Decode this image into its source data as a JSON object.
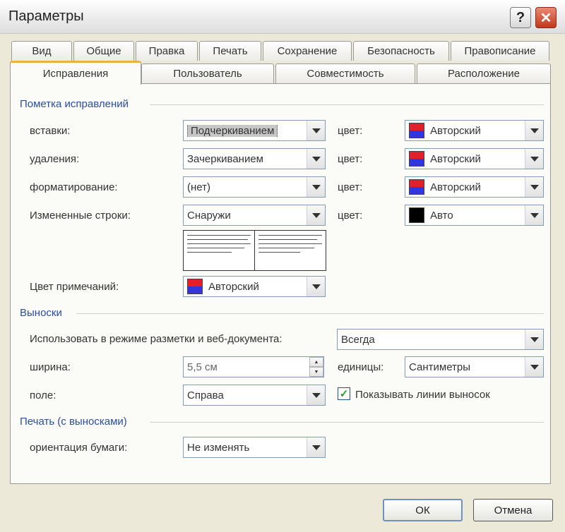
{
  "window": {
    "title": "Параметры",
    "help_label": "?",
    "close_label": "✕"
  },
  "tabs_top": [
    "Вид",
    "Общие",
    "Правка",
    "Печать",
    "Сохранение",
    "Безопасность",
    "Правописание"
  ],
  "tabs_bottom": [
    "Исправления",
    "Пользователь",
    "Совместимость",
    "Расположение"
  ],
  "groups": {
    "markup": "Пометка исправлений",
    "balloons": "Выноски",
    "print": "Печать (с выносками)"
  },
  "markup": {
    "insertions": {
      "label": "вставки:",
      "value": "Подчеркиванием",
      "color_label": "цвет:",
      "color_value": "Авторский"
    },
    "deletions": {
      "label": "удаления:",
      "value": "Зачеркиванием",
      "color_label": "цвет:",
      "color_value": "Авторский"
    },
    "formatting": {
      "label": "форматирование:",
      "value": "(нет)",
      "color_label": "цвет:",
      "color_value": "Авторский"
    },
    "changed_lines": {
      "label": "Измененные строки:",
      "value": "Снаружи",
      "color_label": "цвет:",
      "color_value": "Авто"
    },
    "comments_color": {
      "label": "Цвет примечаний:",
      "value": "Авторский"
    }
  },
  "balloons": {
    "use_in": {
      "label": "Использовать в режиме разметки и веб-документа:",
      "value": "Всегда"
    },
    "width": {
      "label": "ширина:",
      "value": "5,5 см"
    },
    "units": {
      "label": "единицы:",
      "value": "Сантиметры"
    },
    "margin": {
      "label": "поле:",
      "value": "Справа"
    },
    "show_lines": {
      "label": "Показывать линии выносок",
      "checked": true
    }
  },
  "print": {
    "orientation": {
      "label": "ориентация бумаги:",
      "value": "Не изменять"
    }
  },
  "buttons": {
    "ok": "ОК",
    "cancel": "Отмена"
  },
  "colors": {
    "accent_tab": "#f0b040",
    "group_label": "#2c4e9c",
    "author_top": "#e0202a",
    "author_bottom": "#3535d9"
  }
}
